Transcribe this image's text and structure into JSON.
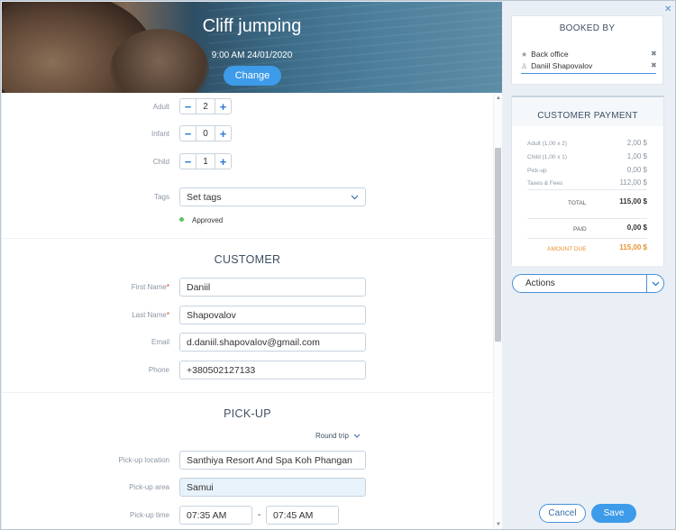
{
  "hero": {
    "title": "Cliff jumping",
    "datetime": "9:00 AM 24/01/2020",
    "change_label": "Change"
  },
  "participants": [
    {
      "label": "Adult",
      "value": "2"
    },
    {
      "label": "Infant",
      "value": "0"
    },
    {
      "label": "Child",
      "value": "1"
    }
  ],
  "tags": {
    "label": "Tags",
    "value": "Set tags",
    "status": "Approved"
  },
  "customer": {
    "title": "CUSTOMER",
    "first_name_label": "First Name",
    "first_name": "Daniil",
    "last_name_label": "Last Name",
    "last_name": "Shapovalov",
    "email_label": "Email",
    "email": "d.daniil.shapovalov@gmail.com",
    "phone_label": "Phone",
    "phone": "+380502127133",
    "required_mark": "*"
  },
  "pickup": {
    "title": "PICK-UP",
    "trip_type": "Round trip",
    "location_label": "Pick-up location",
    "location": "Santhiya Resort And Spa Koh Phangan",
    "area_label": "Pick-up area",
    "area": "Samui",
    "time_label": "Pick-up time",
    "time_from": "07:35 AM",
    "time_separator": "-",
    "time_to": "07:45 AM"
  },
  "booked_by": {
    "title": "BOOKED BY",
    "items": [
      "Back office",
      "Daniil Shapovalov"
    ]
  },
  "payment": {
    "title": "CUSTOMER PAYMENT",
    "lines": [
      {
        "label": "Adult (1,00 x 2)",
        "value": "2,00 $"
      },
      {
        "label": "Child (1,00 x 1)",
        "value": "1,00 $"
      },
      {
        "label": "Pick-up",
        "value": "0,00 $"
      },
      {
        "label": "Taxes & Fees",
        "value": "112,00 $"
      }
    ],
    "total_label": "TOTAL",
    "total": "115,00 $",
    "paid_label": "PAID",
    "paid": "0,00 $",
    "due_label": "AMOUNT DUE",
    "due": "115,00 $"
  },
  "actions": {
    "label": "Actions"
  },
  "footer": {
    "cancel_label": "Cancel",
    "save_label": "Save"
  },
  "colors": {
    "accent": "#3d9be9",
    "due": "#e8922e",
    "approved": "#5cc45d",
    "required": "#e0362f"
  }
}
